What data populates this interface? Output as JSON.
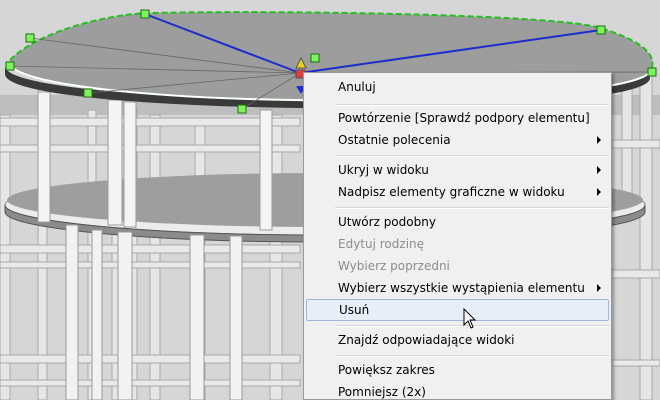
{
  "viewport": {
    "background_color": "#d4d4d4",
    "slab_color": "#9b9b9b",
    "selection_edge_color": "#22c01e",
    "selected_line_color": "#1e2ccc"
  },
  "context_menu": {
    "items": [
      {
        "label": "Anuluj",
        "disabled": false,
        "submenu": false
      },
      {
        "label": "Powtórzenie [Sprawdź podpory elementu]",
        "disabled": false,
        "submenu": false
      },
      {
        "label": "Ostatnie polecenia",
        "disabled": false,
        "submenu": true
      },
      {
        "label": "Ukryj w widoku",
        "disabled": false,
        "submenu": true
      },
      {
        "label": "Nadpisz elementy graficzne w widoku",
        "disabled": false,
        "submenu": true
      },
      {
        "label": "Utwórz podobny",
        "disabled": false,
        "submenu": false
      },
      {
        "label": "Edytuj rodzinę",
        "disabled": true,
        "submenu": false
      },
      {
        "label": "Wybierz poprzedni",
        "disabled": true,
        "submenu": false
      },
      {
        "label": "Wybierz wszystkie wystąpienia elementu",
        "disabled": false,
        "submenu": true
      },
      {
        "label": "Usuń",
        "disabled": false,
        "submenu": false,
        "hovered": true
      },
      {
        "label": "Znajdź odpowiadające widoki",
        "disabled": false,
        "submenu": false
      },
      {
        "label": "Powiększ zakres",
        "disabled": false,
        "submenu": false
      },
      {
        "label": "Pomniejsz (2x)",
        "disabled": false,
        "submenu": false
      }
    ]
  }
}
